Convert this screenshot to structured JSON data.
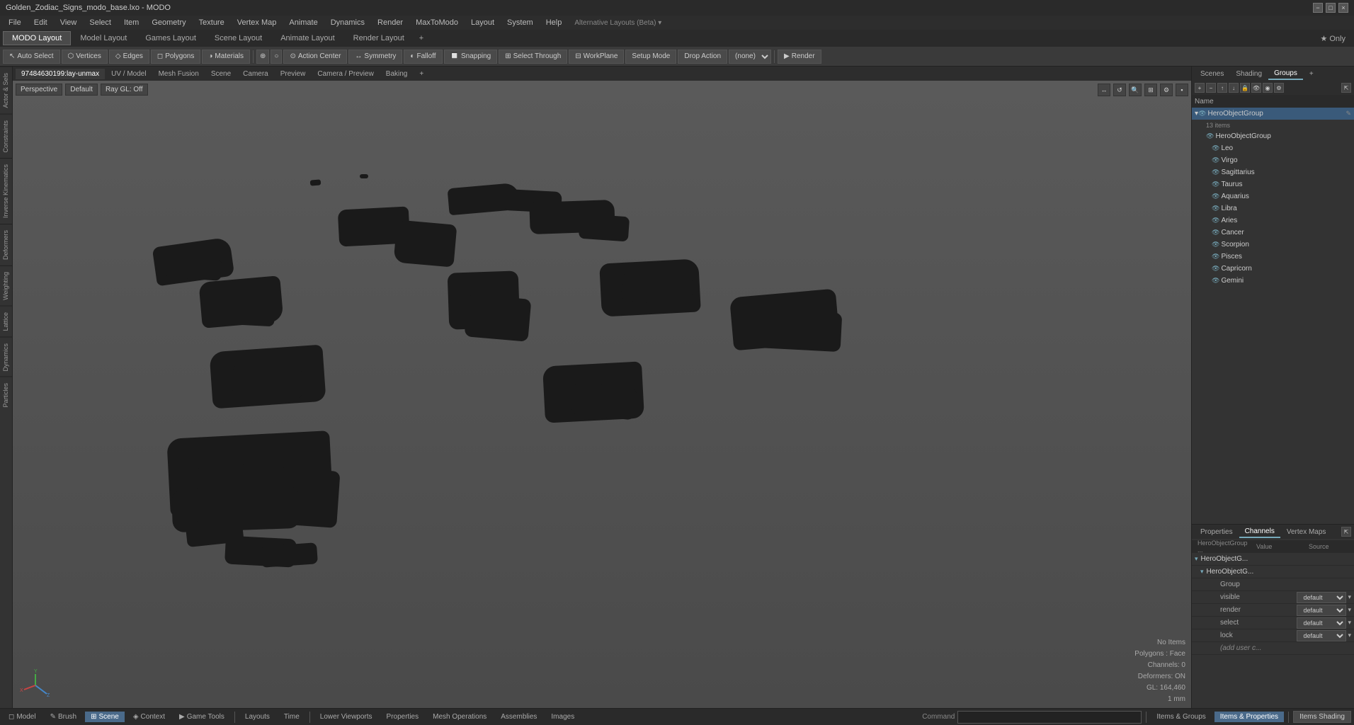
{
  "window": {
    "title": "Golden_Zodiac_Signs_modo_base.lxo - MODO"
  },
  "menu": {
    "items": [
      "File",
      "Edit",
      "View",
      "Select",
      "Item",
      "Geometry",
      "Texture",
      "Vertex Map",
      "Animate",
      "Dynamics",
      "Render",
      "MaxToModo",
      "Layout",
      "System",
      "Help"
    ]
  },
  "layout_tabs": {
    "items": [
      "MODO Layout",
      "Model Layout",
      "Games Layout",
      "Scene Layout",
      "Animate Layout",
      "Render Layout"
    ],
    "active": 0,
    "star_only": "★ Only",
    "add_tab": "+"
  },
  "toolbar": {
    "auto_select": "Auto Select",
    "vertices": "Vertices",
    "edges": "Edges",
    "polygons": "Polygons",
    "materials": "Materials",
    "action_center": "Action Center",
    "symmetry": "Symmetry",
    "falloff": "Falloff",
    "snapping": "Snapping",
    "select_through": "Select Through",
    "workplane": "WorkPlane",
    "setup_mode": "Setup Mode",
    "drop_action": "Drop Action",
    "dropdown_none": "(none)",
    "render": "Render"
  },
  "viewport_tabs": {
    "items": [
      "97484630199:lay-unmax",
      "UV / Model",
      "Mesh Fusion",
      "Scene",
      "Camera",
      "Preview",
      "Camera / Preview",
      "Baking"
    ],
    "active": 0,
    "add": "+"
  },
  "viewport": {
    "perspective": "Perspective",
    "default": "Default",
    "ray_gl": "Ray GL: Off",
    "status": {
      "no_items": "No Items",
      "polygons": "Polygons : Face",
      "channels": "Channels: 0",
      "deformers": "Deformers: ON",
      "gl": "GL: 164,460",
      "unit": "1 mm"
    }
  },
  "left_sidebar": {
    "tabs": [
      "Actor & Sels",
      "Constraints",
      "Inverse Kinematics",
      "Deformers",
      "Weighting",
      "Lattice",
      "Dynamics",
      "Particles"
    ]
  },
  "right_panel": {
    "tabs": [
      "Scenes",
      "Shading",
      "Groups"
    ],
    "active": 2
  },
  "scene_panel": {
    "toolbar_icons": [
      "+",
      "-",
      "↑",
      "↓",
      "⚙"
    ],
    "columns": {
      "name": "Name"
    },
    "root_group": {
      "name": "HeroObjectGroup",
      "count": "13 items",
      "children": [
        {
          "label": "HeroObjectGroup",
          "type": "group"
        },
        {
          "label": "Leo",
          "type": "mesh"
        },
        {
          "label": "Virgo",
          "type": "mesh"
        },
        {
          "label": "Sagittarius",
          "type": "mesh"
        },
        {
          "label": "Taurus",
          "type": "mesh"
        },
        {
          "label": "Aquarius",
          "type": "mesh"
        },
        {
          "label": "Libra",
          "type": "mesh"
        },
        {
          "label": "Aries",
          "type": "mesh"
        },
        {
          "label": "Cancer",
          "type": "mesh"
        },
        {
          "label": "Scorpion",
          "type": "mesh"
        },
        {
          "label": "Pisces",
          "type": "mesh"
        },
        {
          "label": "Capricorn",
          "type": "mesh"
        },
        {
          "label": "Gemini",
          "type": "mesh"
        }
      ]
    }
  },
  "properties_panel": {
    "tabs": [
      "Properties",
      "Channels",
      "Vertex Maps"
    ],
    "active": 1,
    "header": {
      "group_label": "HeroObjectGroup ...",
      "value_col": "Value",
      "source_col": "Source"
    },
    "group_row": "HeroObjectG...",
    "group_sub_row": "HeroObjectG...",
    "properties": [
      {
        "key": "Group"
      },
      {
        "key": "visible",
        "value": "default"
      },
      {
        "key": "render",
        "value": "default"
      },
      {
        "key": "select",
        "value": "default"
      },
      {
        "key": "lock",
        "value": "default"
      },
      {
        "key": "(add user c..."
      }
    ]
  },
  "bottom_bar": {
    "tabs": [
      "Model",
      "Brush",
      "Scene",
      "Context",
      "Game Tools"
    ],
    "active_tab": 2,
    "center_tabs": [
      "Layouts",
      "Time"
    ],
    "right_tabs": [
      "Lower Viewports",
      "Properties",
      "Mesh Operations",
      "Assemblies",
      "Images"
    ],
    "cmd_label": "Command",
    "cmd_placeholder": "",
    "right_extra_tabs": [
      "Items & Groups",
      "Items & Properties"
    ],
    "items_shading": "Items Shading"
  },
  "colors": {
    "active_tab_bg": "#4a6a8a",
    "accent": "#7aabcc",
    "selected_item_bg": "#3a5a7a"
  }
}
